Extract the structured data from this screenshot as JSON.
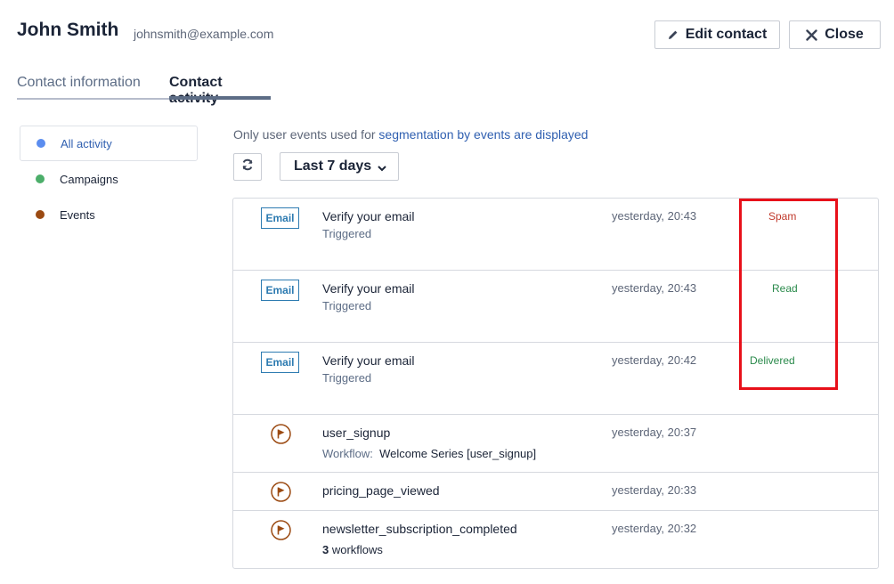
{
  "contact": {
    "name": "John Smith",
    "email": "johnsmith@example.com"
  },
  "header_buttons": {
    "edit_label": "Edit contact",
    "close_label": "Close"
  },
  "tabs": [
    {
      "label": "Contact information",
      "active": false
    },
    {
      "label": "Contact activity",
      "active": true
    }
  ],
  "filters": [
    {
      "label": "All activity",
      "color": "#5b8def",
      "active": true
    },
    {
      "label": "Campaigns",
      "color": "#4cae6a",
      "active": false
    },
    {
      "label": "Events",
      "color": "#9b4a12",
      "active": false
    }
  ],
  "note": {
    "prefix": "Only user events used for ",
    "link": "segmentation by events are displayed"
  },
  "range_select": {
    "value": "Last 7 days"
  },
  "icons": {
    "edit": "pencil-icon",
    "close": "close-icon",
    "refresh": "refresh-icon",
    "dropdown": "chevron-down-icon",
    "event": "flag-circle-icon"
  },
  "colors": {
    "accent": "#2f5fb0",
    "badge": "#2d7bb1",
    "spam": "#c0392b",
    "read": "#2a8a4b",
    "delivered": "#2a8a4b",
    "event_icon": "#9b4a12",
    "highlight": "#e8101a"
  },
  "activities": [
    {
      "type": "email",
      "badge": "Email",
      "title": "Verify your email",
      "subtitle": "Triggered",
      "time": "yesterday, 20:43",
      "status": "Spam"
    },
    {
      "type": "email",
      "badge": "Email",
      "title": "Verify your email",
      "subtitle": "Triggered",
      "time": "yesterday, 20:43",
      "status": "Read"
    },
    {
      "type": "email",
      "badge": "Email",
      "title": "Verify your email",
      "subtitle": "Triggered",
      "time": "yesterday, 20:42",
      "status": "Delivered"
    },
    {
      "type": "event",
      "title": "user_signup",
      "workflow_label": "Workflow:",
      "workflow_value": "Welcome Series [user_signup]",
      "time": "yesterday, 20:37"
    },
    {
      "type": "event",
      "title": "pricing_page_viewed",
      "time": "yesterday, 20:33"
    },
    {
      "type": "event",
      "title": "newsletter_subscription_completed",
      "workflow_count": "3",
      "workflow_count_label": "workflows",
      "time": "yesterday, 20:32"
    }
  ]
}
